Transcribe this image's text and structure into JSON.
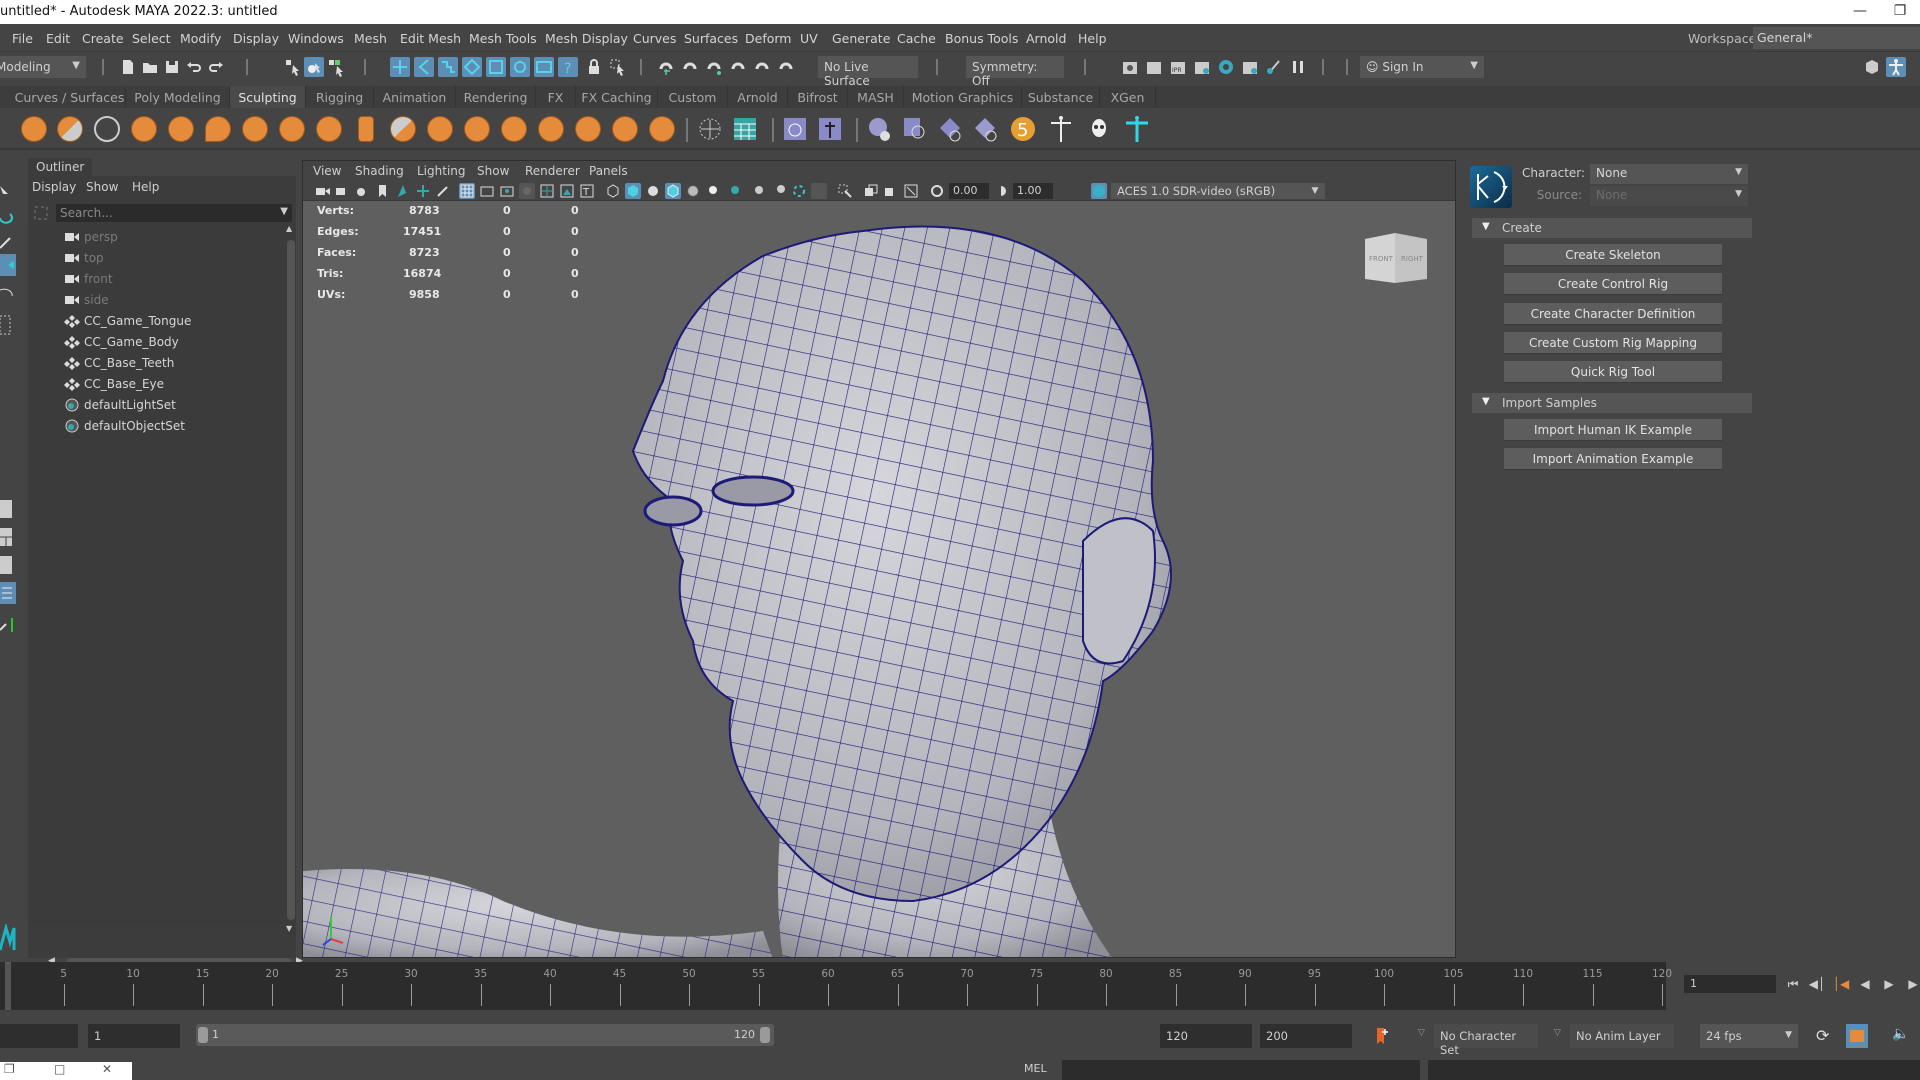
{
  "window": {
    "title": "untitled* - Autodesk MAYA 2022.3: untitled",
    "minimize_icon": "minimize-icon",
    "restore_icon": "restore-icon"
  },
  "menubar": {
    "items": [
      "File",
      "Edit",
      "Create",
      "Select",
      "Modify",
      "Display",
      "Windows",
      "Mesh",
      "Edit Mesh",
      "Mesh Tools",
      "Mesh Display",
      "Curves",
      "Surfaces",
      "Deform",
      "UV",
      "Generate",
      "Cache",
      "Bonus Tools",
      "Arnold",
      "Help"
    ],
    "workspace_label": "Workspace:",
    "workspace_value": "General*"
  },
  "statusline": {
    "mode": "Modeling",
    "live_surface": "No Live Surface",
    "symmetry": "Symmetry: Off",
    "sign_in": "Sign In"
  },
  "shelf": {
    "tabs": [
      "Curves / Surfaces",
      "Poly Modeling",
      "Sculpting",
      "Rigging",
      "Animation",
      "Rendering",
      "FX",
      "FX Caching",
      "Custom",
      "Arnold",
      "Bifrost",
      "MASH",
      "Motion Graphics",
      "Substance",
      "XGen"
    ],
    "active_tab": "Sculpting",
    "icons": [
      "sculpt-tool-icon",
      "smooth-tool-icon",
      "relax-tool-icon",
      "grab-tool-icon",
      "pinch-tool-icon",
      "flatten-tool-icon",
      "foamy-tool-icon",
      "spray-tool-icon",
      "repeat-tool-icon",
      "imprint-tool-icon",
      "wax-tool-icon",
      "scrape-tool-icon",
      "fill-tool-icon",
      "knife-tool-icon",
      "smear-tool-icon",
      "bulge-tool-icon",
      "amplify-tool-icon",
      "freeze-tool-icon",
      "convert-to-frozen-icon",
      "layer-editor-icon",
      "blend-shape-editor-icon",
      "shape-editor-icon",
      "sculpt-geometry-icon",
      "soft-mod-icon",
      "texture-deformer-icon",
      "cluster-icon",
      "number-5-icon",
      "skeleton-icon",
      "skull-icon",
      "cyan-skeleton-icon"
    ]
  },
  "outliner": {
    "tab": "Outliner",
    "menus": [
      "Display",
      "Show",
      "Help"
    ],
    "search_placeholder": "Search...",
    "items": [
      {
        "label": "persp",
        "icon": "camera-icon",
        "dim": true
      },
      {
        "label": "top",
        "icon": "camera-icon",
        "dim": true
      },
      {
        "label": "front",
        "icon": "camera-icon",
        "dim": true
      },
      {
        "label": "side",
        "icon": "camera-icon",
        "dim": true
      },
      {
        "label": "CC_Game_Tongue",
        "icon": "transform-icon",
        "dim": false
      },
      {
        "label": "CC_Game_Body",
        "icon": "transform-icon",
        "dim": false
      },
      {
        "label": "CC_Base_Teeth",
        "icon": "transform-icon",
        "dim": false
      },
      {
        "label": "CC_Base_Eye",
        "icon": "transform-icon",
        "dim": false
      },
      {
        "label": "defaultLightSet",
        "icon": "set-icon",
        "dim": false
      },
      {
        "label": "defaultObjectSet",
        "icon": "set-icon",
        "dim": false
      }
    ]
  },
  "viewport": {
    "menus": [
      "View",
      "Shading",
      "Lighting",
      "Show",
      "Renderer",
      "Panels"
    ],
    "exposure": "0.00",
    "gamma": "1.00",
    "color_space": "ACES 1.0 SDR-video (sRGB)",
    "viewcube": {
      "front": "FRONT",
      "right": "RIGHT"
    },
    "hud": [
      {
        "label": "Verts:",
        "values": [
          "8783",
          "0",
          "0"
        ]
      },
      {
        "label": "Edges:",
        "values": [
          "17451",
          "0",
          "0"
        ]
      },
      {
        "label": "Faces:",
        "values": [
          "8723",
          "0",
          "0"
        ]
      },
      {
        "label": "Tris:",
        "values": [
          "16874",
          "0",
          "0"
        ]
      },
      {
        "label": "UVs:",
        "values": [
          "9858",
          "0",
          "0"
        ]
      }
    ]
  },
  "humanik": {
    "character_label": "Character:",
    "character_value": "None",
    "source_label": "Source:",
    "source_value": "None",
    "sections": [
      {
        "title": "Create",
        "buttons": [
          "Create Skeleton",
          "Create Control Rig",
          "Create Character Definition",
          "Create Custom Rig Mapping",
          "Quick Rig Tool"
        ]
      },
      {
        "title": "Import Samples",
        "buttons": [
          "Import Human IK Example",
          "Import Animation Example"
        ]
      }
    ]
  },
  "timeslider": {
    "ticks": [
      5,
      10,
      15,
      20,
      25,
      30,
      35,
      40,
      45,
      50,
      55,
      60,
      65,
      70,
      75,
      80,
      85,
      90,
      95,
      100,
      105,
      110,
      115,
      120
    ],
    "range": [
      1,
      120
    ],
    "current_frame": "1"
  },
  "rangebar": {
    "start": "1",
    "slider_start": "1",
    "slider_end": "120",
    "end": "120",
    "anim_end": "200",
    "character_set": "No Character Set",
    "anim_layer": "No Anim Layer",
    "fps": "24 fps"
  },
  "cmdline": {
    "language": "MEL"
  }
}
